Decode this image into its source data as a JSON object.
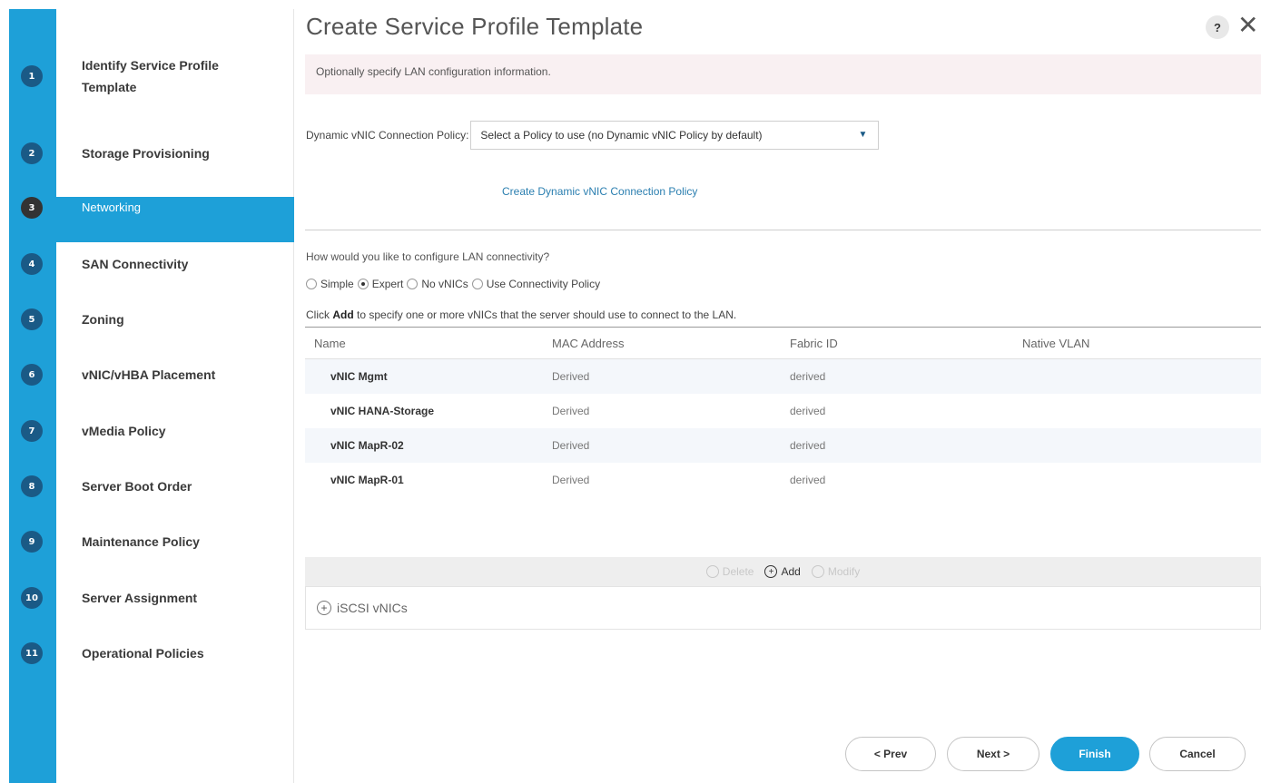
{
  "wizard": {
    "title": "Create Service Profile Template",
    "help_icon_text": "?",
    "close_icon_text": "✕"
  },
  "steps": [
    {
      "num": "1",
      "label_line1": "Identify Service Profile",
      "label_line2": "Template"
    },
    {
      "num": "2",
      "label": "Storage Provisioning"
    },
    {
      "num": "3",
      "label": "Networking",
      "active": true
    },
    {
      "num": "4",
      "label": "SAN Connectivity"
    },
    {
      "num": "5",
      "label": "Zoning"
    },
    {
      "num": "6",
      "label": "vNIC/vHBA Placement"
    },
    {
      "num": "7",
      "label": "vMedia Policy"
    },
    {
      "num": "8",
      "label": "Server Boot Order"
    },
    {
      "num": "9",
      "label": "Maintenance Policy"
    },
    {
      "num": "10",
      "label": "Server Assignment"
    },
    {
      "num": "11",
      "label": "Operational Policies"
    }
  ],
  "main": {
    "banner": "Optionally specify LAN configuration information.",
    "policy_label": "Dynamic vNIC Connection Policy:",
    "policy_select_value": "Select a Policy to use (no Dynamic vNIC Policy by default)",
    "create_link": "Create Dynamic vNIC Connection Policy",
    "question": "How would you like to configure LAN connectivity?",
    "radios": [
      {
        "label": "Simple",
        "checked": false
      },
      {
        "label": "Expert",
        "checked": true
      },
      {
        "label": "No vNICs",
        "checked": false
      },
      {
        "label": "Use Connectivity Policy",
        "checked": false
      }
    ],
    "click_prefix": "Click ",
    "click_bold": "Add",
    "click_suffix": " to specify one or more vNICs that the server should use to connect to the LAN."
  },
  "table": {
    "headers": [
      "Name",
      "MAC Address",
      "Fabric ID",
      "Native VLAN"
    ],
    "rows": [
      {
        "name": "vNIC Mgmt",
        "mac": "Derived",
        "fabric": "derived"
      },
      {
        "name": "vNIC HANA-Storage",
        "mac": "Derived",
        "fabric": "derived"
      },
      {
        "name": "vNIC MapR-02",
        "mac": "Derived",
        "fabric": "derived"
      },
      {
        "name": "vNIC MapR-01",
        "mac": "Derived",
        "fabric": "derived"
      }
    ]
  },
  "actions": {
    "delete": "Delete",
    "add": "Add",
    "modify": "Modify"
  },
  "iscsi": {
    "label": "iSCSI vNICs"
  },
  "footer": {
    "prev": "< Prev",
    "next": "Next >",
    "finish": "Finish",
    "cancel": "Cancel"
  },
  "colors": {
    "accent": "#1ea0d8",
    "step_badge": "#1a5a86",
    "link": "#2b7fb0"
  }
}
